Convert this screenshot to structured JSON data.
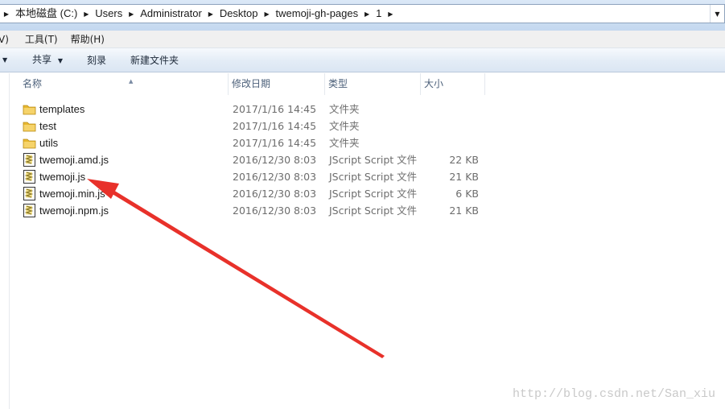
{
  "address": {
    "crumbs": [
      "本地磁盘 (C:)",
      "Users",
      "Administrator",
      "Desktop",
      "twemoji-gh-pages",
      "1"
    ]
  },
  "menu": {
    "view_partial": "V)",
    "tools": "工具(T)",
    "help": "帮助(H)"
  },
  "commands": {
    "share": "共享",
    "burn": "刻录",
    "new_folder": "新建文件夹"
  },
  "columns": {
    "name": "名称",
    "date": "修改日期",
    "type": "类型",
    "size": "大小"
  },
  "files": [
    {
      "name": "templates",
      "date": "2017/1/16 14:45",
      "type": "文件夹",
      "size": "",
      "icon": "folder-icon"
    },
    {
      "name": "test",
      "date": "2017/1/16 14:45",
      "type": "文件夹",
      "size": "",
      "icon": "folder-icon"
    },
    {
      "name": "utils",
      "date": "2017/1/16 14:45",
      "type": "文件夹",
      "size": "",
      "icon": "folder-icon"
    },
    {
      "name": "twemoji.amd.js",
      "date": "2016/12/30 8:03",
      "type": "JScript Script 文件",
      "size": "22 KB",
      "icon": "jscript-file-icon"
    },
    {
      "name": "twemoji.js",
      "date": "2016/12/30 8:03",
      "type": "JScript Script 文件",
      "size": "21 KB",
      "icon": "jscript-file-icon"
    },
    {
      "name": "twemoji.min.js",
      "date": "2016/12/30 8:03",
      "type": "JScript Script 文件",
      "size": "6 KB",
      "icon": "jscript-file-icon"
    },
    {
      "name": "twemoji.npm.js",
      "date": "2016/12/30 8:03",
      "type": "JScript Script 文件",
      "size": "21 KB",
      "icon": "jscript-file-icon"
    }
  ],
  "annotation": {
    "arrow_color": "#e8312a"
  },
  "watermark": "http://blog.csdn.net/San_xiu",
  "colors": {
    "folder": "#e8b830",
    "header_text": "#4c607a",
    "detail_text": "#6d6d6d"
  }
}
